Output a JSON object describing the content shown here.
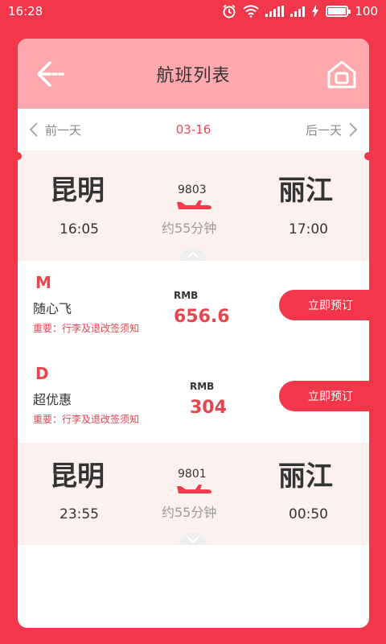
{
  "status": {
    "time": "16:28",
    "battery": "100",
    "network": "4G"
  },
  "header": {
    "title": "航班列表"
  },
  "datebar": {
    "prev_label": "前一天",
    "current_date": "03-16",
    "next_label": "后一天"
  },
  "flights": [
    {
      "from_city": "昆明",
      "to_city": "丽江",
      "depart_time": "16:05",
      "arrive_time": "17:00",
      "flight_no": "9803",
      "duration": "约55分钟",
      "expanded": true,
      "fares": [
        {
          "code": "M",
          "name": "随心飞",
          "notice": "重要：行李及退改签须知",
          "currency": "RMB",
          "price": "656.6",
          "book_label": "立即预订"
        },
        {
          "code": "D",
          "name": "超优惠",
          "notice": "重要：行李及退改签须知",
          "currency": "RMB",
          "price": "304",
          "book_label": "立即预订"
        }
      ]
    },
    {
      "from_city": "昆明",
      "to_city": "丽江",
      "depart_time": "23:55",
      "arrive_time": "00:50",
      "flight_no": "9801",
      "duration": "约55分钟",
      "expanded": false,
      "fares": []
    }
  ],
  "colors": {
    "brand": "#f2374a",
    "header": "#ffa8ad",
    "route_bg": "#fdf1ef",
    "accent_text": "#e8464f"
  }
}
